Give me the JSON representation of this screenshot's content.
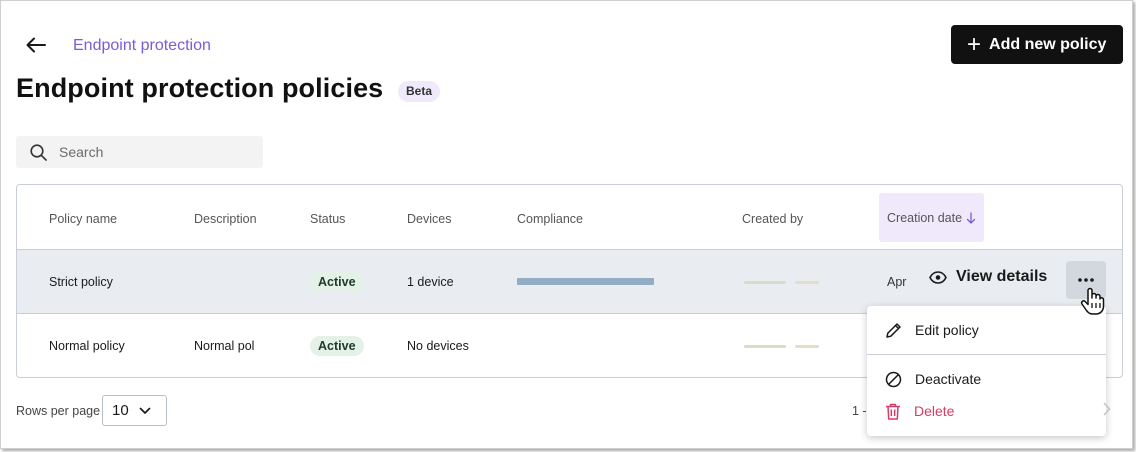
{
  "header": {
    "breadcrumb": "Endpoint protection",
    "title": "Endpoint protection policies",
    "badge": "Beta",
    "add_button": "Add new policy"
  },
  "search": {
    "placeholder": "Search",
    "value": ""
  },
  "table": {
    "columns": [
      "Policy name",
      "Description",
      "Status",
      "Devices",
      "Compliance",
      "Created by",
      "Creation date"
    ],
    "sorted_column": "Creation date",
    "sort_direction": "descending",
    "rows": [
      {
        "name": "Strict policy",
        "description": "",
        "status": "Active",
        "devices": "1 device",
        "compliance": 1.0,
        "creation_date": "Apr"
      },
      {
        "name": "Normal policy",
        "description": "Normal pol",
        "status": "Active",
        "devices": "No devices",
        "compliance": null,
        "creation_date": ""
      }
    ],
    "row_actions": {
      "view_details": "View details"
    }
  },
  "context_menu": {
    "items": [
      {
        "label": "Edit policy",
        "icon": "pencil-icon"
      },
      {
        "label": "Deactivate",
        "icon": "block-icon"
      },
      {
        "label": "Delete",
        "icon": "trash-icon",
        "color": "#d63c64"
      }
    ]
  },
  "footer": {
    "rows_per_page_label": "Rows per page",
    "rows_per_page_value": "10",
    "range_text": "1 -"
  },
  "colors": {
    "accent": "#7b5bd6",
    "primary_button": "#111111",
    "beta_badge": "#efe9fb",
    "active_badge": "#e3f1e6",
    "compliance_bar": "#93adc7",
    "selected_row": "#e9edf2",
    "danger": "#d63c64"
  }
}
